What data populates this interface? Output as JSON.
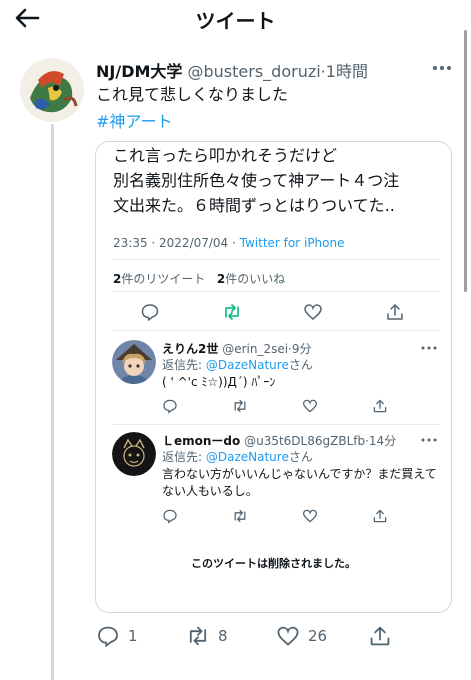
{
  "header": {
    "title": "ツイート"
  },
  "tweet": {
    "author_name": "NJ/DM大学",
    "handle": "@busters_doruzi",
    "separator": "·",
    "time": "1時間",
    "text": "これ見て悲しくなりました",
    "hashtag": "#神アート",
    "actions": {
      "reply_count": "1",
      "retweet_count": "8",
      "like_count": "26"
    }
  },
  "quote": {
    "lines": [
      "これ言ったら叩かれそうだけど",
      "別名義別住所色々使って神アート４つ注",
      "文出来た。６時間ずっとはりついてた.."
    ],
    "timestamp": "23:35 · 2022/07/04 · ",
    "via": "Twitter for iPhone",
    "retweets_num": "2",
    "retweets_label": "件のリツイート",
    "likes_num": "2",
    "likes_label": "件のいいね"
  },
  "replies": [
    {
      "name": "えりん2世",
      "handle": "@erin_2sei",
      "time": "·9分",
      "reply_to_prefix": "返信先: ",
      "reply_to_user": "@DazeNature",
      "reply_to_suffix": "さん",
      "text": "( ' ^'c ﾐ☆))Д´) ﾊﾟｰﾝ"
    },
    {
      "name": "Ｌemonーdo",
      "handle": "@u35t6DL86gZBLfb",
      "time": "·14分",
      "reply_to_prefix": "返信先: ",
      "reply_to_user": "@DazeNature",
      "reply_to_suffix": "さん",
      "text": "言わない方がいいんじゃないんですか？まだ買えてない人もいるし。"
    }
  ],
  "deleted_notice": "このツイートは削除されました。",
  "colors": {
    "accent": "#1d9bf0",
    "retweet_green": "#00ba7c",
    "muted": "#536471"
  }
}
